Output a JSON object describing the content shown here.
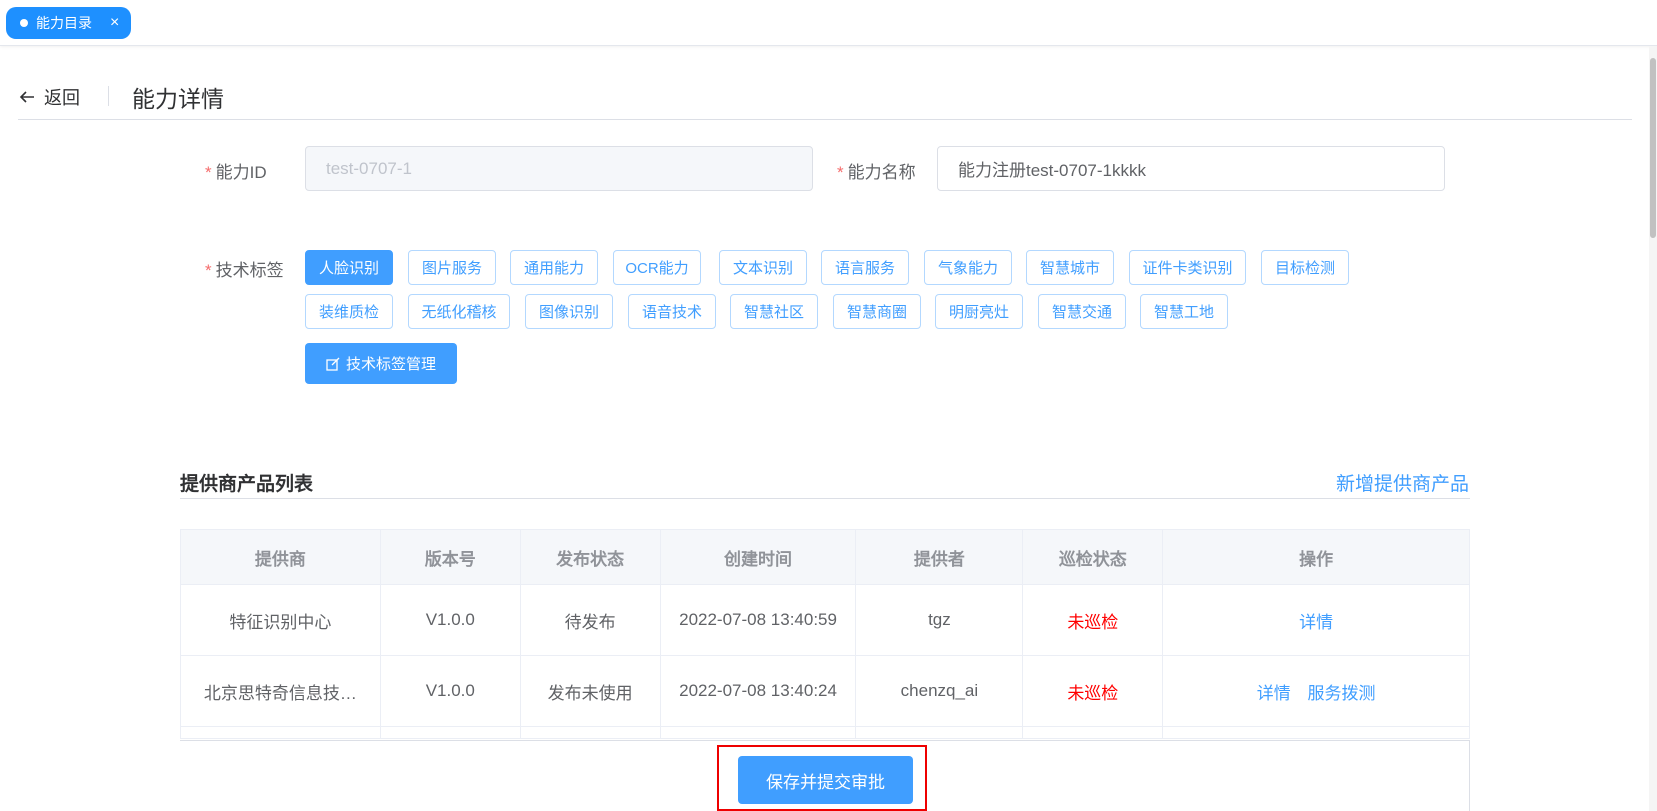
{
  "tabbar": {
    "tab_label": "能力目录",
    "close_glyph": "×"
  },
  "header": {
    "back_label": "返回",
    "title": "能力详情"
  },
  "form": {
    "id_label": "能力ID",
    "id_value": "test-0707-1",
    "name_label": "能力名称",
    "name_value": "能力注册test-0707-1kkkk",
    "tags_label": "技术标签",
    "required_mark": "*",
    "tags_row1": [
      "人脸识别",
      "图片服务",
      "通用能力",
      "OCR能力",
      "文本识别",
      "语言服务",
      "气象能力",
      "智慧城市",
      "证件卡类识别",
      "目标检测"
    ],
    "tags_row2": [
      "装维质检",
      "无纸化稽核",
      "图像识别",
      "语音技术",
      "智慧社区",
      "智慧商圈",
      "明厨亮灶",
      "智慧交通",
      "智慧工地"
    ],
    "selected_tag": "人脸识别",
    "manage_button": "技术标签管理"
  },
  "providers": {
    "section_title": "提供商产品列表",
    "add_link": "新增提供商产品",
    "columns": [
      "提供商",
      "版本号",
      "发布状态",
      "创建时间",
      "提供者",
      "巡检状态",
      "操作"
    ],
    "rows": [
      {
        "provider": "特征识别中心",
        "version": "V1.0.0",
        "status": "待发布",
        "created": "2022-07-08 13:40:59",
        "by": "tgz",
        "check": "未巡检",
        "actions": [
          "详情"
        ]
      },
      {
        "provider": "北京思特奇信息技…",
        "version": "V1.0.0",
        "status": "发布未使用",
        "created": "2022-07-08 13:40:24",
        "by": "chenzq_ai",
        "check": "未巡检",
        "actions": [
          "详情",
          "服务拨测"
        ]
      }
    ]
  },
  "footer": {
    "submit_button": "保存并提交审批"
  },
  "colors": {
    "primary": "#409eff",
    "tab": "#1e90ff",
    "alert": "#ff0000",
    "highlight": "#e00000"
  }
}
